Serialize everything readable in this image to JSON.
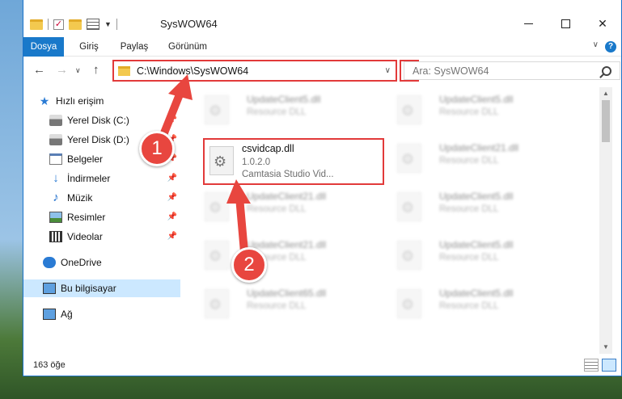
{
  "window": {
    "title": "SysWOW64",
    "minimize": "",
    "maximize": "",
    "close": "✕"
  },
  "ribbon": {
    "tabs": [
      {
        "label": "Dosya",
        "active": true
      },
      {
        "label": "Giriş",
        "active": false
      },
      {
        "label": "Paylaş",
        "active": false
      },
      {
        "label": "Görünüm",
        "active": false
      }
    ],
    "help": "?"
  },
  "nav": {
    "address": "C:\\Windows\\SysWOW64",
    "search_placeholder": "Ara: SysWOW64"
  },
  "sidebar": {
    "items": [
      {
        "label": "Hızlı erişim",
        "icon": "star-icon"
      },
      {
        "label": "Yerel Disk (C:)",
        "icon": "disk-icon",
        "pinned": true
      },
      {
        "label": "Yerel Disk (D:)",
        "icon": "disk-icon",
        "pinned": true
      },
      {
        "label": "Belgeler",
        "icon": "documents-icon",
        "pinned": true
      },
      {
        "label": "İndirmeler",
        "icon": "download-icon",
        "pinned": true
      },
      {
        "label": "Müzik",
        "icon": "music-icon",
        "pinned": true
      },
      {
        "label": "Resimler",
        "icon": "pictures-icon",
        "pinned": true
      },
      {
        "label": "Videolar",
        "icon": "videos-icon",
        "pinned": true
      },
      {
        "label": "OneDrive",
        "icon": "cloud-icon"
      },
      {
        "label": "Bu bilgisayar",
        "icon": "computer-icon",
        "selected": true
      },
      {
        "label": "Ağ",
        "icon": "network-icon"
      }
    ]
  },
  "files": {
    "featured": {
      "name": "csvidcap.dll",
      "version": "1.0.2.0",
      "description": "Camtasia Studio Vid..."
    },
    "background": [
      {
        "name": "UpdateClient5.dll",
        "type": "Resource DLL"
      },
      {
        "name": "UpdateClient5.dll",
        "type": "Resource DLL"
      },
      {
        "name": "UpdateClient21.dll",
        "type": "Resource DLL"
      },
      {
        "name": "UpdateClient21.dll",
        "type": "Resource DLL"
      },
      {
        "name": "UpdateClient5.dll",
        "type": "Resource DLL"
      },
      {
        "name": "UpdateClient21.dll",
        "type": "Resource DLL"
      },
      {
        "name": "UpdateClient5.dll",
        "type": "Resource DLL"
      },
      {
        "name": "UpdateClient65.dll",
        "type": "Resource DLL"
      },
      {
        "name": "UpdateClient5.dll",
        "type": "Resource DLL"
      }
    ]
  },
  "status": {
    "count": "163 öğe"
  },
  "annotations": {
    "step1": "1",
    "step2": "2",
    "color": "#e8463f"
  },
  "colors": {
    "accent": "#1979ca",
    "highlight": "#e23a3a",
    "selection": "#cce8ff"
  }
}
